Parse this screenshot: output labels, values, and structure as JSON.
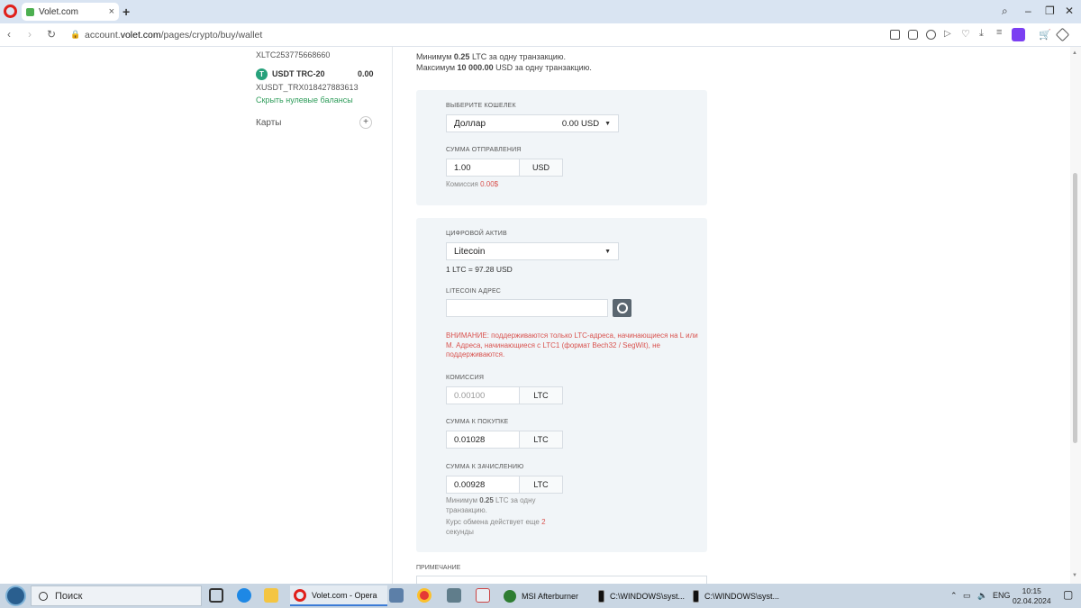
{
  "browser": {
    "tab_title": "Volet.com",
    "url_prefix": "account.",
    "url_domain": "volet.com",
    "url_path": "/pages/crypto/buy/wallet"
  },
  "sidebar": {
    "ltc_id": "XLTC253775668660",
    "usdt_name": "USDT TRC-20",
    "usdt_balance": "0.00",
    "usdt_id": "XUSDT_TRX018427883613",
    "hide_zero": "Скрыть нулевые балансы",
    "cards_label": "Карты"
  },
  "info": {
    "min_prefix": "Минимум ",
    "min_value": "0.25",
    "min_suffix": " LTC за одну транзакцию.",
    "max_prefix": "Максимум ",
    "max_value": "10 000.00",
    "max_suffix": " USD за одну транзакцию."
  },
  "wallet_panel": {
    "wallet_label": "Выберите кошелек",
    "wallet_name": "Доллар",
    "wallet_balance": "0.00 USD",
    "amount_label": "Сумма отправления",
    "amount_value": "1.00",
    "amount_unit": "USD",
    "fee_text": "Комиссия ",
    "fee_value": "0.00$"
  },
  "crypto_panel": {
    "asset_label": "Цифровой актив",
    "asset_name": "Litecoin",
    "rate_prefix": "1 LTC = ",
    "rate_value": "97.28 USD",
    "address_label": "Litecoin адрес",
    "warning": "ВНИМАНИЕ: поддерживаются только LTC-адреса, начинающиеся на L или M. Адреса, начинающиеся с LTC1 (формат Bech32 / SegWit), не поддерживаются.",
    "commission_label": "Комиссия",
    "commission_value": "0.00100",
    "commission_unit": "LTC",
    "buy_label": "Сумма к покупке",
    "buy_value": "0.01028",
    "buy_unit": "LTC",
    "credit_label": "Сумма к зачислению",
    "credit_value": "0.00928",
    "credit_unit": "LTC",
    "min_hint_1": "Минимум ",
    "min_hint_value": "0.25",
    "min_hint_2": " LTC за одну",
    "min_hint_3": "транзакцию.",
    "rate_hint_1": "Курс обмена действует еще ",
    "rate_hint_value": "2",
    "rate_hint_2": "секунды"
  },
  "note_label": "Примечание",
  "taskbar": {
    "search_label": "Поиск",
    "opera_window": "Volet.com - Opera",
    "msi_window": "MSI Afterburner",
    "cmd_window_1": "C:\\WINDOWS\\syst...",
    "cmd_window_2": "C:\\WINDOWS\\syst...",
    "lang": "ENG",
    "time": "10:15",
    "date": "02.04.2024"
  },
  "colors": {
    "accent_green": "#2e9c5a",
    "warning_red": "#d9534f",
    "panel_bg": "#f1f5f8"
  }
}
